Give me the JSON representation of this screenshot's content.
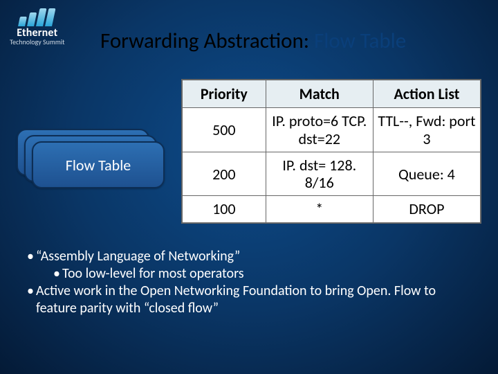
{
  "logo": {
    "name": "Ethernet",
    "sub": "Technology Summit"
  },
  "title": {
    "main": "Forwarding Abstraction: ",
    "accent": "Flow Table"
  },
  "stack_label": "Flow Table",
  "table": {
    "headers": [
      "Priority",
      "Match",
      "Action List"
    ],
    "rows": [
      {
        "priority": "500",
        "match": "IP. proto=6 TCP. dst=22",
        "action": "TTL--, Fwd: port 3"
      },
      {
        "priority": "200",
        "match": "IP. dst= 128. 8/16",
        "action": "Queue: 4"
      },
      {
        "priority": "100",
        "match": "*",
        "action": "DROP"
      }
    ]
  },
  "bullets": {
    "b1": "“Assembly Language of Networking”",
    "b1a": "Too low-level for most operators",
    "b2": "Active work in the Open Networking Foundation to bring Open. Flow to feature parity with “closed flow”"
  }
}
